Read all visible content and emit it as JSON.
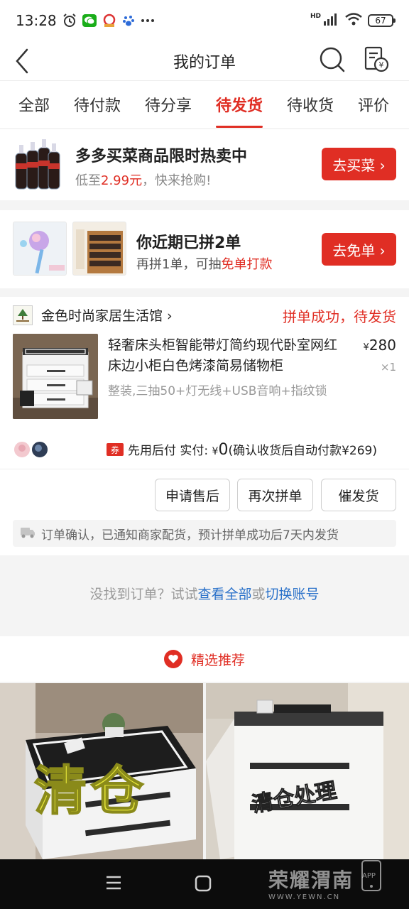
{
  "status_bar": {
    "time": "13:28",
    "hd": "HD",
    "battery": "67"
  },
  "header": {
    "title": "我的订单"
  },
  "tabs": [
    "全部",
    "待付款",
    "待分享",
    "待发货",
    "待收货",
    "评价"
  ],
  "active_tab": "待发货",
  "promo_veg": {
    "title": "多多买菜商品限时热卖中",
    "sub_prefix": "低至",
    "sub_price": "2.99元",
    "sub_suffix": "，快来抢购!",
    "button": "去买菜 ›"
  },
  "promo_free": {
    "title": "你近期已拼2单",
    "sub_prefix": "再拼1单，可抽",
    "sub_highlight": "免单打款",
    "button": "去免单 ›"
  },
  "order": {
    "shop_name": "金色时尚家居生活馆 ›",
    "status": "拼单成功，待发货",
    "product_title": "轻奢床头柜智能带灯简约现代卧室网红床边小柜白色烤漆简易储物柜",
    "price_symbol": "¥",
    "price": "280",
    "quantity": "×1",
    "spec": "整装,三抽50+灯无线+USB音响+指纹锁",
    "coupon": "券",
    "pay_label": "先用后付 实付: ",
    "pay_symbol": "¥",
    "pay_amount": "0",
    "pay_note": "(确认收货后自动付款¥269)",
    "buttons": {
      "after_sale": "申请售后",
      "rebuy": "再次拼单",
      "urge": "催发货"
    },
    "notice": "订单确认，已通知商家配货，预计拼单成功后7天内发货"
  },
  "not_found": {
    "prefix": "没找到订单？试试",
    "link1": "查看全部",
    "middle": "或",
    "link2": "切换账号"
  },
  "recommend": {
    "title": "精选推荐",
    "item1_banner": "清仓",
    "item2_banner": "清仓处理"
  },
  "watermark": {
    "cn": "荣耀渭南",
    "en": "WWW.YEWN.CN",
    "app": "APP"
  },
  "colors": {
    "accent": "#e02e24",
    "link": "#2a71c9"
  }
}
